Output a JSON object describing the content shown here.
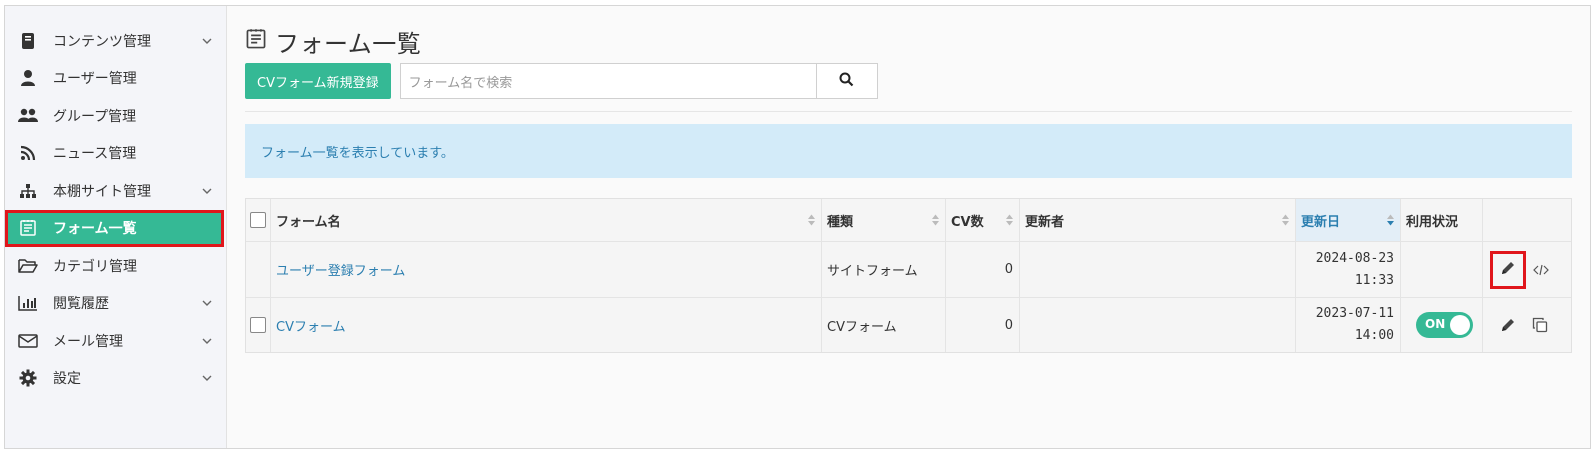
{
  "sidebar": {
    "items": [
      {
        "label": "コンテンツ管理",
        "icon": "book-icon",
        "chevron": true
      },
      {
        "label": "ユーザー管理",
        "icon": "user-icon",
        "chevron": false
      },
      {
        "label": "グループ管理",
        "icon": "users-icon",
        "chevron": false
      },
      {
        "label": "ニュース管理",
        "icon": "rss-icon",
        "chevron": false
      },
      {
        "label": "本棚サイト管理",
        "icon": "sitemap-icon",
        "chevron": true
      },
      {
        "label": "フォーム一覧",
        "icon": "form-icon",
        "chevron": false,
        "active": true
      },
      {
        "label": "カテゴリ管理",
        "icon": "folder-icon",
        "chevron": false
      },
      {
        "label": "閲覧履歴",
        "icon": "chart-icon",
        "chevron": true
      },
      {
        "label": "メール管理",
        "icon": "mail-icon",
        "chevron": true
      },
      {
        "label": "設定",
        "icon": "gear-icon",
        "chevron": true
      }
    ]
  },
  "page": {
    "title": "フォーム一覧",
    "new_button": "CVフォーム新規登録",
    "search_placeholder": "フォーム名で検索",
    "info": "フォーム一覧を表示しています。"
  },
  "table": {
    "columns": [
      "フォーム名",
      "種類",
      "CV数",
      "更新者",
      "更新日",
      "利用状況"
    ],
    "rows": [
      {
        "name": "ユーザー登録フォーム",
        "type": "サイトフォーム",
        "cv": "0",
        "updater": "",
        "date": "2024-08-23",
        "time": "11:33",
        "status": "",
        "has_checkbox": false
      },
      {
        "name": "CVフォーム",
        "type": "CVフォーム",
        "cv": "0",
        "updater": "",
        "date": "2023-07-11",
        "time": "14:00",
        "status": "ON",
        "has_checkbox": true
      }
    ]
  },
  "colors": {
    "accent": "#35b995",
    "link": "#2c7fb0",
    "info_bg": "#d3ebf9",
    "highlight": "#e0161b"
  }
}
